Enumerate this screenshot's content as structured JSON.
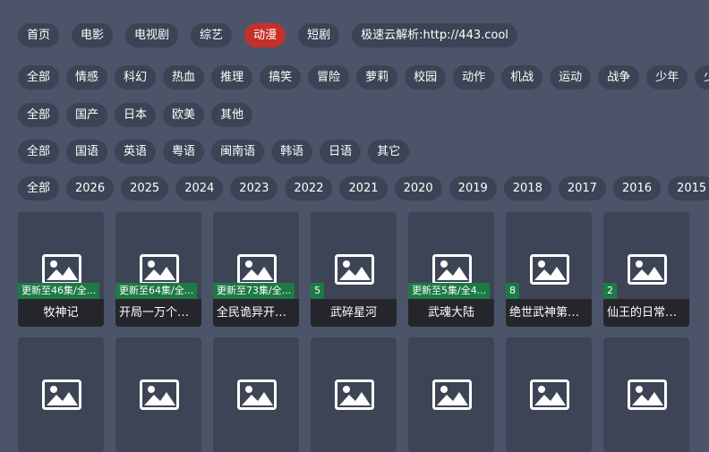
{
  "nav": [
    "首页",
    "电影",
    "电视剧",
    "综艺",
    "动漫",
    "短剧",
    "极速云解析:http://443.cool"
  ],
  "nav_active_index": 4,
  "filters": {
    "genre": [
      "全部",
      "情感",
      "科幻",
      "热血",
      "推理",
      "搞笑",
      "冒险",
      "萝莉",
      "校园",
      "动作",
      "机战",
      "运动",
      "战争",
      "少年",
      "少女"
    ],
    "region": [
      "全部",
      "国产",
      "日本",
      "欧美",
      "其他"
    ],
    "language": [
      "全部",
      "国语",
      "英语",
      "粤语",
      "闽南语",
      "韩语",
      "日语",
      "其它"
    ],
    "year": [
      "全部",
      "2026",
      "2025",
      "2024",
      "2023",
      "2022",
      "2021",
      "2020",
      "2019",
      "2018",
      "2017",
      "2016",
      "2015"
    ]
  },
  "cards": [
    {
      "badge": "更新至46集/全...",
      "title": "牧神记"
    },
    {
      "badge": "更新至64集/全...",
      "title": "开局一万个俯..."
    },
    {
      "badge": "更新至73集/全...",
      "title": "全民诡异开局..."
    },
    {
      "badge": "5",
      "title": "武碎星河"
    },
    {
      "badge": "更新至5集/全4...",
      "title": "武魂大陆"
    },
    {
      "badge": "8",
      "title": "绝世武神第八..."
    },
    {
      "badge": "2",
      "title": "仙王的日常生..."
    }
  ],
  "second_row_count": 7,
  "colors": {
    "background": "#4b5468",
    "chip": "#3b4354",
    "active_chip": "#c6302b",
    "badge": "#1e7a45",
    "title_bar": "#24262b"
  },
  "icons": {
    "thumbnail": "image-placeholder-icon"
  }
}
